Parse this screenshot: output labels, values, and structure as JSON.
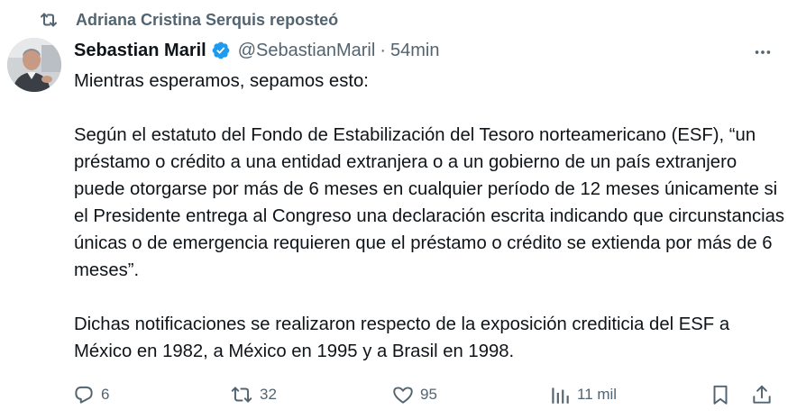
{
  "repost": {
    "text": "Adriana Cristina Serquis reposteó",
    "icon": "repost-icon"
  },
  "author": {
    "display_name": "Sebastian Maril",
    "handle": "@SebastianMaril",
    "separator": "·",
    "time": "54min",
    "verified_color": "#1d9bf0"
  },
  "body": {
    "paragraphs": [
      "Mientras esperamos, sepamos esto:",
      "Según el estatuto del Fondo de Estabilización del Tesoro norteamericano (ESF), “un préstamo o crédito a una entidad extranjera o a un gobierno de un país extranjero puede otorgarse por más de 6 meses en cualquier período de 12 meses únicamente si el Presidente entrega al Congreso una declaración escrita indicando que circunstancias únicas o de emergencia requieren que el préstamo o crédito se extienda por más de 6 meses”.",
      "Dichas notificaciones se realizaron respecto de la exposición crediticia del ESF a México en 1982, a México en 1995 y a Brasil en 1998."
    ]
  },
  "actions": {
    "replies": "6",
    "reposts": "32",
    "likes": "95",
    "views": "11 mil"
  },
  "colors": {
    "text_primary": "#0f1419",
    "text_secondary": "#536471",
    "accent": "#1d9bf0"
  }
}
